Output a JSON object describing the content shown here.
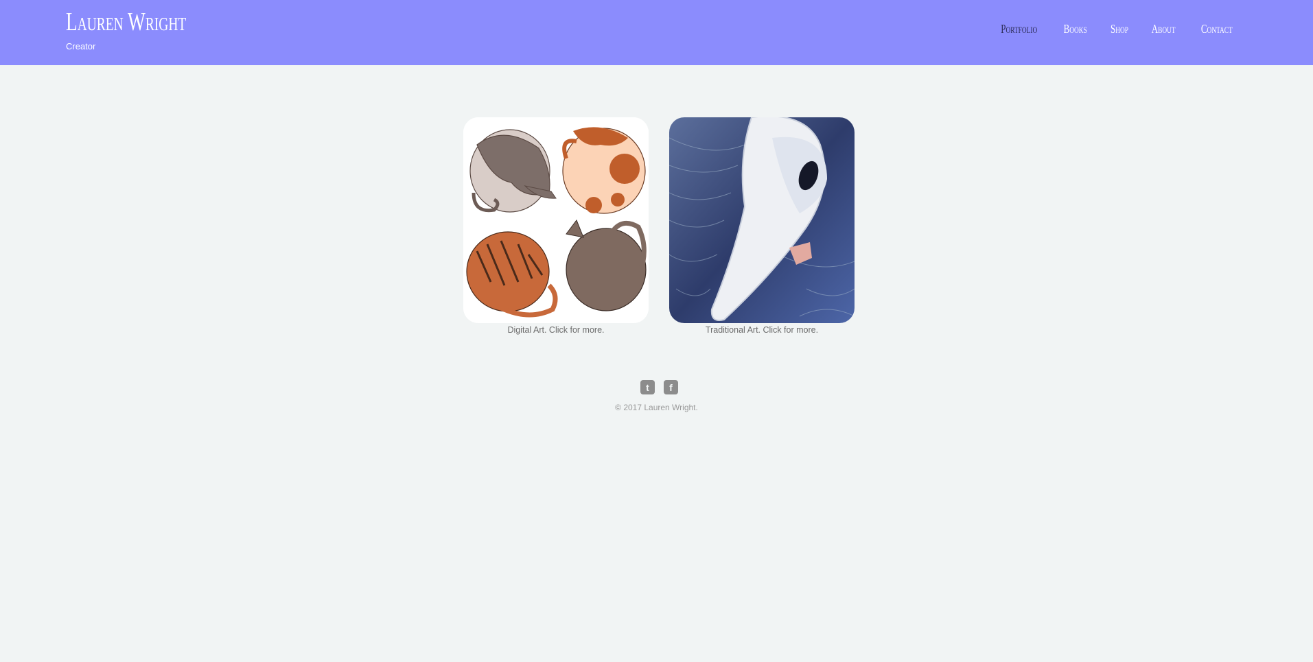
{
  "site": {
    "title": "Lauren Wright",
    "tagline": "Creator"
  },
  "nav": {
    "items": [
      {
        "label": "Portfolio",
        "active": true
      },
      {
        "label": "Books",
        "active": false
      },
      {
        "label": "Shop",
        "active": false
      },
      {
        "label": "About",
        "active": false
      },
      {
        "label": "Contact",
        "active": false
      }
    ]
  },
  "gallery": {
    "items": [
      {
        "caption": "Digital Art. Click for more.",
        "image": "sleeping-cats-illustration"
      },
      {
        "caption": "Traditional Art. Click for more.",
        "image": "plague-mask-drawing"
      }
    ]
  },
  "footer": {
    "social": [
      {
        "icon": "twitter-icon",
        "glyph": "t"
      },
      {
        "icon": "facebook-icon",
        "glyph": "f"
      }
    ],
    "copyright": "© 2017 Lauren Wright."
  },
  "colors": {
    "header_bg": "#8b8cfd",
    "page_bg": "#f1f4f4",
    "nav_active": "#2b2b55"
  }
}
